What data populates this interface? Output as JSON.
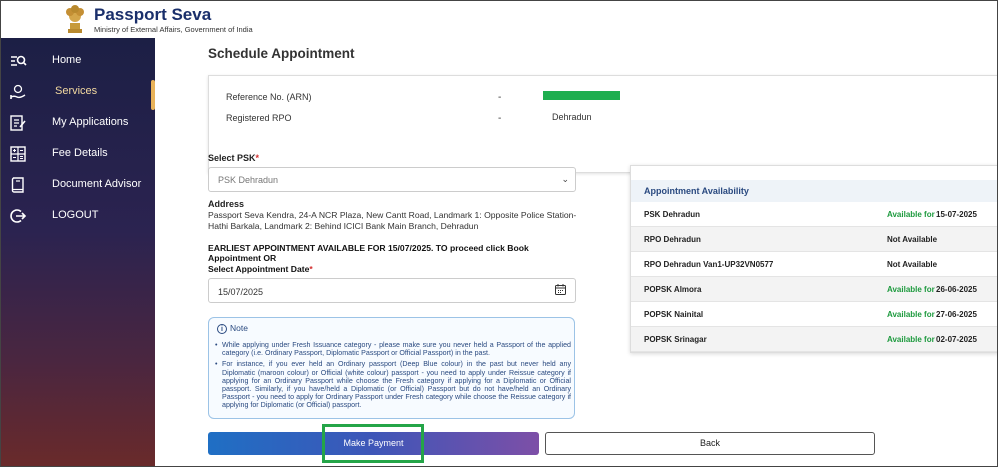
{
  "header": {
    "brand": "Passport Seva",
    "subtitle": "Ministry of External Affairs, Government of India"
  },
  "sidebar": {
    "items": [
      {
        "label": "Home",
        "icon": "search-list-icon"
      },
      {
        "label": "Services",
        "icon": "services-hand-icon"
      },
      {
        "label": "My Applications",
        "icon": "edit-document-icon"
      },
      {
        "label": "Fee Details",
        "icon": "calculator-icon"
      },
      {
        "label": "Document Advisor",
        "icon": "book-icon"
      },
      {
        "label": "LOGOUT",
        "icon": "logout-icon"
      }
    ],
    "active": "Services"
  },
  "page": {
    "title": "Schedule Appointment"
  },
  "info": {
    "arn_label": "Reference No. (ARN)",
    "rpo_label": "Registered RPO",
    "dash": "-",
    "rpo_value": "Dehradun"
  },
  "form": {
    "psk_label": "Select PSK",
    "required_mark": "*",
    "psk_value": "PSK Dehradun",
    "address_heading": "Address",
    "address": "Passport Seva Kendra, 24-A NCR Plaza, New Cantt Road, Landmark 1: Opposite Police Station-Hathi Barkala, Landmark 2: Behind ICICI Bank Main Branch, Dehradun",
    "earliest": "EARLIEST APPOINTMENT AVAILABLE FOR 15/07/2025. TO proceed click Book Appointment OR",
    "date_label": "Select Appointment Date",
    "date_value": "15/07/2025"
  },
  "note": {
    "heading": "Note",
    "items": [
      "While applying under Fresh Issuance category - please make sure you never held a Passport of the applied category (i.e. Ordinary Passport, Diplomatic Passport or Official Passport) in the past.",
      "For instance, if you ever held an Ordinary passport (Deep Blue colour) in the past but never held any Diplomatic (maroon colour) or Official (white colour) passport - you need to apply under Reissue category if applying for an Ordinary Passport while choose the Fresh category if applying for a Diplomatic or Official passport. Similarly, if you have/held a Diplomatic (or Official) Passport but do not have/held an Ordinary Passport - you need to apply for Ordinary Passport under Fresh category while choose the Reissue category if applying for Diplomatic (or Official) passport."
    ]
  },
  "buttons": {
    "pay": "Make Payment",
    "back": "Back"
  },
  "availability": {
    "heading": "Appointment Availability",
    "rows": [
      {
        "name": "PSK Dehradun",
        "status": "Available for",
        "date": "15-07-2025",
        "available": true
      },
      {
        "name": "RPO Dehradun",
        "status": "Not Available",
        "date": "",
        "available": false
      },
      {
        "name": "RPO Dehradun Van1-UP32VN0577",
        "status": "Not Available",
        "date": "",
        "available": false
      },
      {
        "name": "POPSK Almora",
        "status": "Available for",
        "date": "26-06-2025",
        "available": true
      },
      {
        "name": "POPSK Nainital",
        "status": "Available for",
        "date": "27-06-2025",
        "available": true
      },
      {
        "name": "POPSK Srinagar",
        "status": "Available for",
        "date": "02-07-2025",
        "available": true
      }
    ]
  },
  "colors": {
    "sidebar_top": "#1c1f45",
    "sidebar_bottom": "#6a2a2a",
    "available_green": "#1d9a3e",
    "highlight_green": "#24a548",
    "arn_redaction": "#1eae4f"
  }
}
